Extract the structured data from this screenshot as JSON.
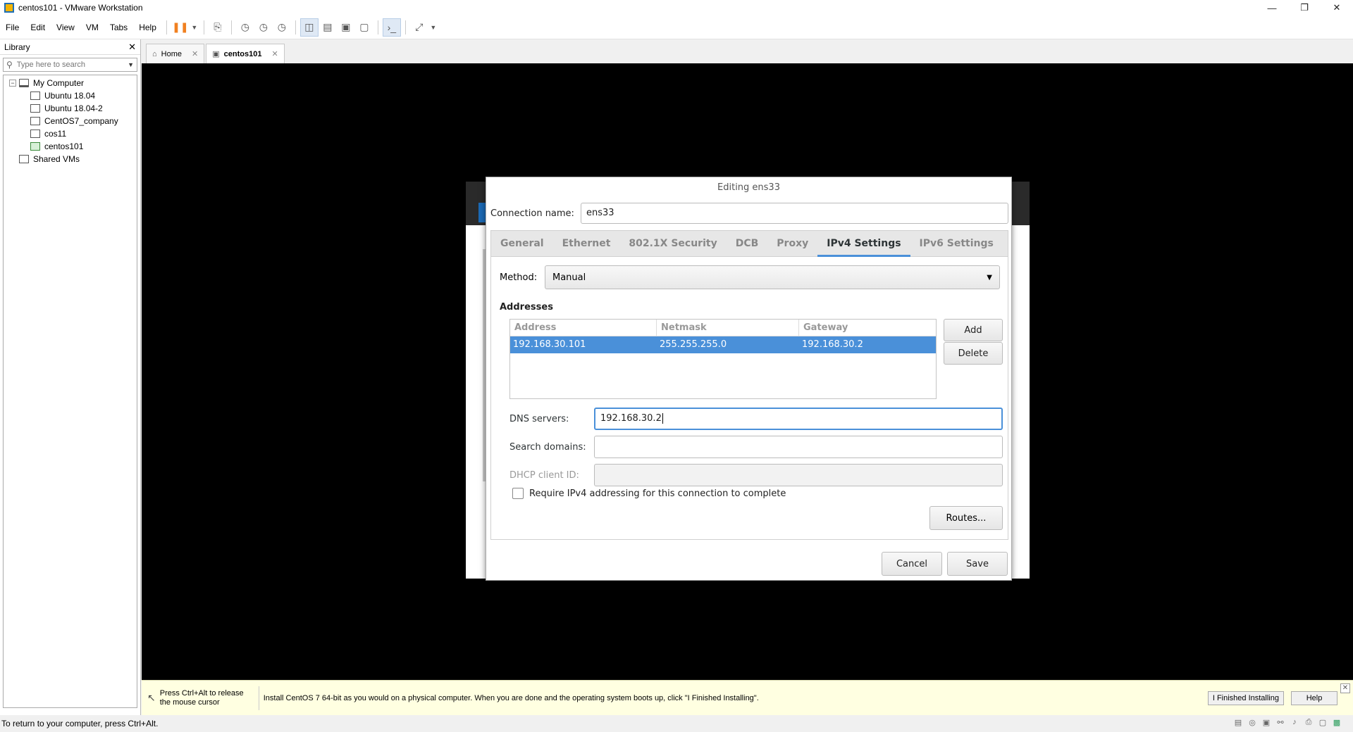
{
  "window": {
    "title": "centos101 - VMware Workstation"
  },
  "menu": [
    "File",
    "Edit",
    "View",
    "VM",
    "Tabs",
    "Help"
  ],
  "library": {
    "title": "Library",
    "search_placeholder": "Type here to search",
    "root": "My Computer",
    "vms": [
      "Ubuntu 18.04",
      "Ubuntu 18.04-2",
      "CentOS7_company",
      "cos11",
      "centos101"
    ],
    "shared": "Shared VMs"
  },
  "tabs": [
    {
      "label": "Home"
    },
    {
      "label": "centos101"
    }
  ],
  "dialog": {
    "title": "Editing ens33",
    "connection_name_label": "Connection name:",
    "connection_name_value": "ens33",
    "tabs": [
      "General",
      "Ethernet",
      "802.1X Security",
      "DCB",
      "Proxy",
      "IPv4 Settings",
      "IPv6 Settings"
    ],
    "active_tab": "IPv4 Settings",
    "method_label": "Method:",
    "method_value": "Manual",
    "addresses_title": "Addresses",
    "columns": [
      "Address",
      "Netmask",
      "Gateway"
    ],
    "rows": [
      {
        "address": "192.168.30.101",
        "netmask": "255.255.255.0",
        "gateway": "192.168.30.2"
      }
    ],
    "add_label": "Add",
    "delete_label": "Delete",
    "dns_label": "DNS servers:",
    "dns_value": "192.168.30.2",
    "search_domains_label": "Search domains:",
    "search_domains_value": "",
    "dhcp_label": "DHCP client ID:",
    "dhcp_value": "",
    "require_label": "Require IPv4 addressing for this connection to complete",
    "routes_label": "Routes...",
    "cancel_label": "Cancel",
    "save_label": "Save"
  },
  "hint": {
    "release": "Press Ctrl+Alt to release the mouse cursor",
    "message": "Install CentOS 7 64-bit as you would on a physical computer. When you are done and the operating system boots up, click \"I Finished Installing\".",
    "finished_label": "I Finished Installing",
    "help_label": "Help"
  },
  "status": {
    "text": "To return to your computer, press Ctrl+Alt."
  }
}
